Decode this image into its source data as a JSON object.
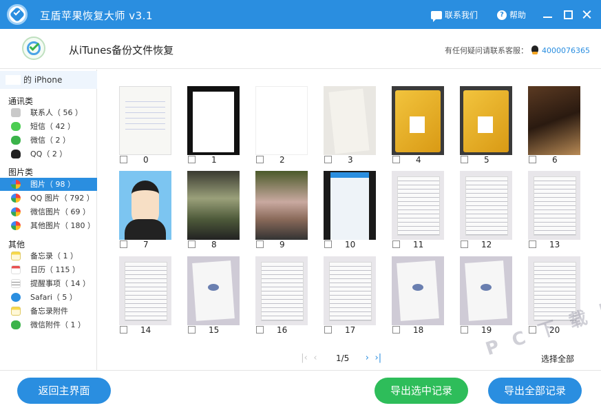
{
  "app": {
    "title": "互盾苹果恢复大师 v3.1",
    "contact_label": "联系我们",
    "help_label": "帮助"
  },
  "header": {
    "title": "从iTunes备份文件恢复",
    "support_label": "有任何疑问请联系客服：",
    "support_phone": "4000076365"
  },
  "sidebar": {
    "device": "的 iPhone",
    "categories": [
      {
        "label": "通讯类",
        "items": [
          {
            "label": "联系人（ 56 ）",
            "icon": "contacts-icon"
          },
          {
            "label": "短信（ 42 ）",
            "icon": "sms-icon"
          },
          {
            "label": "微信（ 2 ）",
            "icon": "wechat-icon"
          },
          {
            "label": "QQ（ 2 ）",
            "icon": "qq-icon"
          }
        ]
      },
      {
        "label": "图片类",
        "items": [
          {
            "label": "图片（ 98 ）",
            "icon": "photos-icon",
            "selected": true
          },
          {
            "label": "QQ 图片（ 792 ）",
            "icon": "photos-icon"
          },
          {
            "label": "微信图片（ 69 ）",
            "icon": "photos-icon"
          },
          {
            "label": "其他图片（ 180 ）",
            "icon": "photos-icon"
          }
        ]
      },
      {
        "label": "其他",
        "items": [
          {
            "label": "备忘录（ 1 ）",
            "icon": "notes-icon"
          },
          {
            "label": "日历（ 115 ）",
            "icon": "calendar-icon"
          },
          {
            "label": "提醒事项（ 14 ）",
            "icon": "reminders-icon"
          },
          {
            "label": "Safari（ 5 ）",
            "icon": "safari-icon"
          },
          {
            "label": "备忘录附件",
            "icon": "note-attachment-icon"
          },
          {
            "label": "微信附件（ 1 ）",
            "icon": "wechat-attachment-icon"
          }
        ]
      }
    ]
  },
  "photos": [
    {
      "label": "0"
    },
    {
      "label": "1"
    },
    {
      "label": "2"
    },
    {
      "label": "3"
    },
    {
      "label": "4"
    },
    {
      "label": "5"
    },
    {
      "label": "6"
    },
    {
      "label": "7"
    },
    {
      "label": "8"
    },
    {
      "label": "9"
    },
    {
      "label": "10"
    },
    {
      "label": "11"
    },
    {
      "label": "12"
    },
    {
      "label": "13"
    },
    {
      "label": "14"
    },
    {
      "label": "15"
    },
    {
      "label": "16"
    },
    {
      "label": "17"
    },
    {
      "label": "18"
    },
    {
      "label": "19"
    },
    {
      "label": "20"
    }
  ],
  "pager": {
    "page_text": "1/5",
    "select_all_label": "选择全部"
  },
  "footer": {
    "back_label": "返回主界面",
    "export_selected_label": "导出选中记录",
    "export_all_label": "导出全部记录"
  },
  "watermark": "P C 下 载 网",
  "colors": {
    "primary": "#2a8ee0",
    "green": "#2ebd5a"
  }
}
